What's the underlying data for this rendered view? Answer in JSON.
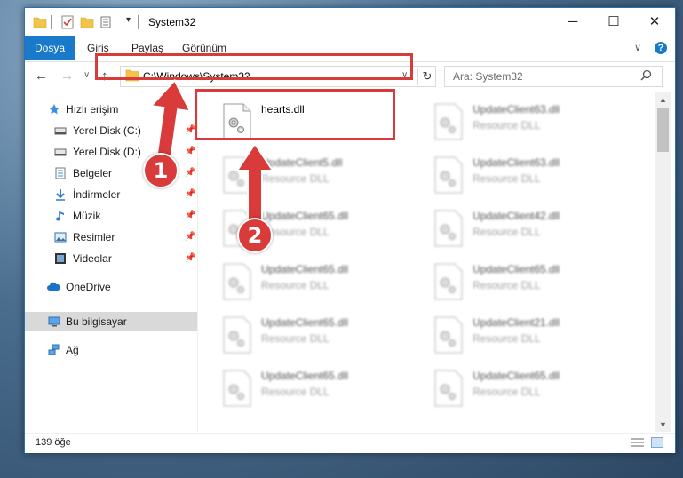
{
  "window": {
    "title": "System32",
    "controls": {
      "minimize": "─",
      "maximize": "☐",
      "close": "✕"
    }
  },
  "ribbon": {
    "tabs": [
      {
        "label": "Dosya",
        "active": true
      },
      {
        "label": "Giriş"
      },
      {
        "label": "Paylaş"
      },
      {
        "label": "Görünüm"
      }
    ],
    "help": "?"
  },
  "address": {
    "path": "C:\\Windows\\System32",
    "refresh": "↻"
  },
  "search": {
    "placeholder": "Ara: System32",
    "icon": "magnifier-icon"
  },
  "nav": {
    "quick_access": "Hızlı erişim",
    "items": [
      {
        "label": "Yerel Disk (C:)",
        "icon": "drive-icon",
        "pinned": true
      },
      {
        "label": "Yerel Disk (D:)",
        "icon": "drive-icon",
        "pinned": true
      },
      {
        "label": "Belgeler",
        "icon": "documents-icon",
        "pinned": true
      },
      {
        "label": "İndirmeler",
        "icon": "downloads-icon",
        "pinned": true
      },
      {
        "label": "Müzik",
        "icon": "music-icon",
        "pinned": true
      },
      {
        "label": "Resimler",
        "icon": "pictures-icon",
        "pinned": true
      },
      {
        "label": "Videolar",
        "icon": "videos-icon",
        "pinned": true
      }
    ],
    "onedrive": "OneDrive",
    "this_pc": "Bu bilgisayar",
    "network": "Ağ"
  },
  "files": {
    "highlighted": {
      "name": "hearts.dll",
      "type": ""
    },
    "left_column": [
      {
        "name": "UpdateClient5.dll",
        "type": "Resource DLL"
      },
      {
        "name": "UpdateClient65.dll",
        "type": "Resource DLL"
      },
      {
        "name": "UpdateClient65.dll",
        "type": "Resource DLL"
      },
      {
        "name": "UpdateClient65.dll",
        "type": "Resource DLL"
      },
      {
        "name": "UpdateClient65.dll",
        "type": "Resource DLL"
      }
    ],
    "right_column": [
      {
        "name": "UpdateClient63.dll",
        "type": "Resource DLL"
      },
      {
        "name": "UpdateClient63.dll",
        "type": "Resource DLL"
      },
      {
        "name": "UpdateClient42.dll",
        "type": "Resource DLL"
      },
      {
        "name": "UpdateClient65.dll",
        "type": "Resource DLL"
      },
      {
        "name": "UpdateClient21.dll",
        "type": "Resource DLL"
      },
      {
        "name": "UpdateClient65.dll",
        "type": "Resource DLL"
      }
    ]
  },
  "status": {
    "item_count": "139 öğe"
  },
  "annotations": {
    "step1": "1",
    "step2": "2",
    "color": "#d93a3a"
  },
  "colors": {
    "accent": "#1979ca",
    "highlight": "#d93a3a",
    "selected": "#d9d9d9"
  }
}
